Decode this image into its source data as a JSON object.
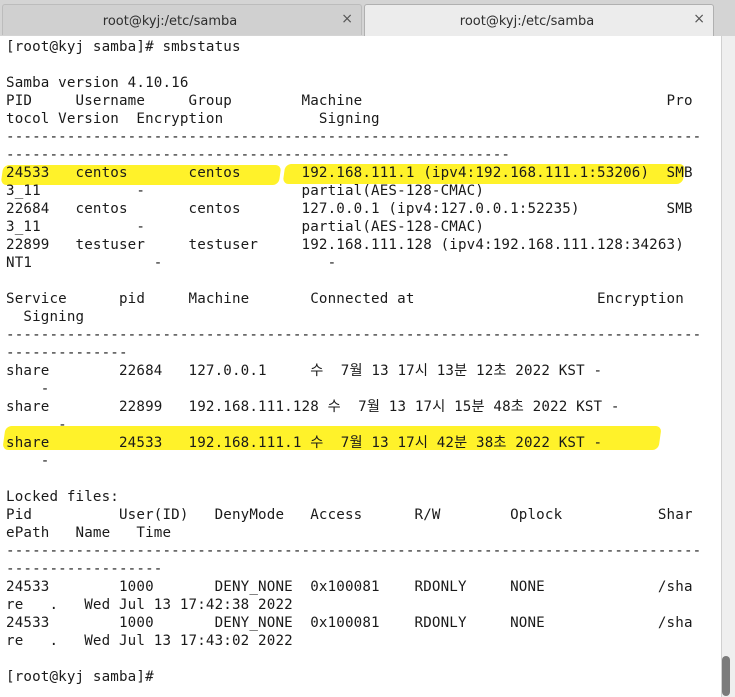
{
  "tabs": [
    {
      "label": "root@kyj:/etc/samba",
      "close": "×",
      "active": false
    },
    {
      "label": "root@kyj:/etc/samba",
      "close": "×",
      "active": true
    }
  ],
  "highlight_color": "#fff22a",
  "terminal": {
    "lines": [
      "[root@kyj samba]# smbstatus",
      "",
      "Samba version 4.10.16",
      "PID     Username     Group        Machine                                   Pro",
      "tocol Version  Encryption           Signing",
      "--------------------------------------------------------------------------------",
      "----------------------------------------------------------",
      "24533   centos       centos       192.168.111.1 (ipv4:192.168.111.1:53206)  SMB",
      "3_11           -                  partial(AES-128-CMAC)",
      "22684   centos       centos       127.0.0.1 (ipv4:127.0.0.1:52235)          SMB",
      "3_11           -                  partial(AES-128-CMAC)",
      "22899   testuser     testuser     192.168.111.128 (ipv4:192.168.111.128:34263)",
      "NT1              -                   -",
      "",
      "Service      pid     Machine       Connected at                     Encryption",
      "  Signing",
      "--------------------------------------------------------------------------------",
      "--------------",
      "share        22684   127.0.0.1     수  7월 13 17시 13분 12초 2022 KST -",
      "    -",
      "share        22899   192.168.111.128 수  7월 13 17시 15분 48초 2022 KST -",
      "      -",
      "share        24533   192.168.111.1 수  7월 13 17시 42분 38초 2022 KST -",
      "    -",
      "",
      "Locked files:",
      "Pid          User(ID)   DenyMode   Access      R/W        Oplock           Shar",
      "ePath   Name   Time",
      "--------------------------------------------------------------------------------",
      "------------------",
      "24533        1000       DENY_NONE  0x100081    RDONLY     NONE             /sha",
      "re   .   Wed Jul 13 17:42:38 2022",
      "24533        1000       DENY_NONE  0x100081    RDONLY     NONE             /sha",
      "re   .   Wed Jul 13 17:43:02 2022",
      "",
      "[root@kyj samba]# "
    ]
  }
}
